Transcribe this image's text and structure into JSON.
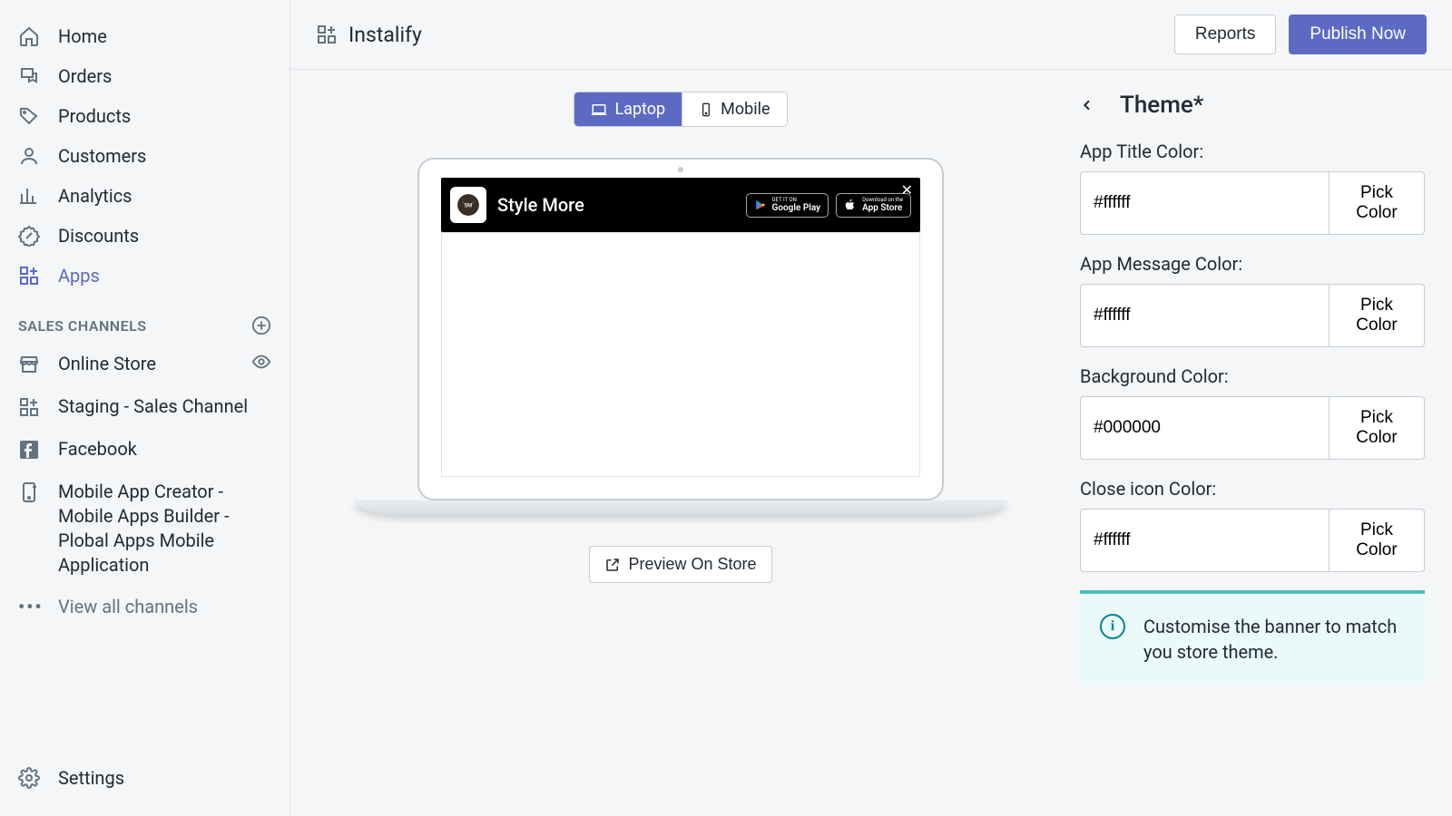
{
  "sidebar": {
    "items": [
      {
        "label": "Home"
      },
      {
        "label": "Orders"
      },
      {
        "label": "Products"
      },
      {
        "label": "Customers"
      },
      {
        "label": "Analytics"
      },
      {
        "label": "Discounts"
      },
      {
        "label": "Apps"
      }
    ],
    "sales_channels_header": "SALES CHANNELS",
    "channels": [
      {
        "label": "Online Store"
      },
      {
        "label": "Staging - Sales Channel"
      },
      {
        "label": "Facebook"
      },
      {
        "label": "Mobile App Creator - Mobile Apps Builder - Plobal Apps Mobile Application"
      }
    ],
    "view_all": "View all channels",
    "settings": "Settings"
  },
  "topbar": {
    "title": "Instalify",
    "reports": "Reports",
    "publish": "Publish Now"
  },
  "device_toggle": {
    "laptop": "Laptop",
    "mobile": "Mobile"
  },
  "banner_preview": {
    "app_title": "Style More",
    "google_play_small": "GET IT ON",
    "google_play_big": "Google Play",
    "app_store_small": "Download on the",
    "app_store_big": "App Store"
  },
  "preview_button": "Preview On Store",
  "panel": {
    "title": "Theme*",
    "fields": [
      {
        "label": "App Title Color:",
        "value": "#ffffff",
        "pick": "Pick Color"
      },
      {
        "label": "App Message Color:",
        "value": "#ffffff",
        "pick": "Pick Color"
      },
      {
        "label": "Background Color:",
        "value": "#000000",
        "pick": "Pick Color"
      },
      {
        "label": "Close icon Color:",
        "value": "#ffffff",
        "pick": "Pick Color"
      }
    ],
    "info": "Customise the banner to match you store theme."
  },
  "colors": {
    "primary": "#5c6ac4",
    "teal": "#47c1bf"
  }
}
